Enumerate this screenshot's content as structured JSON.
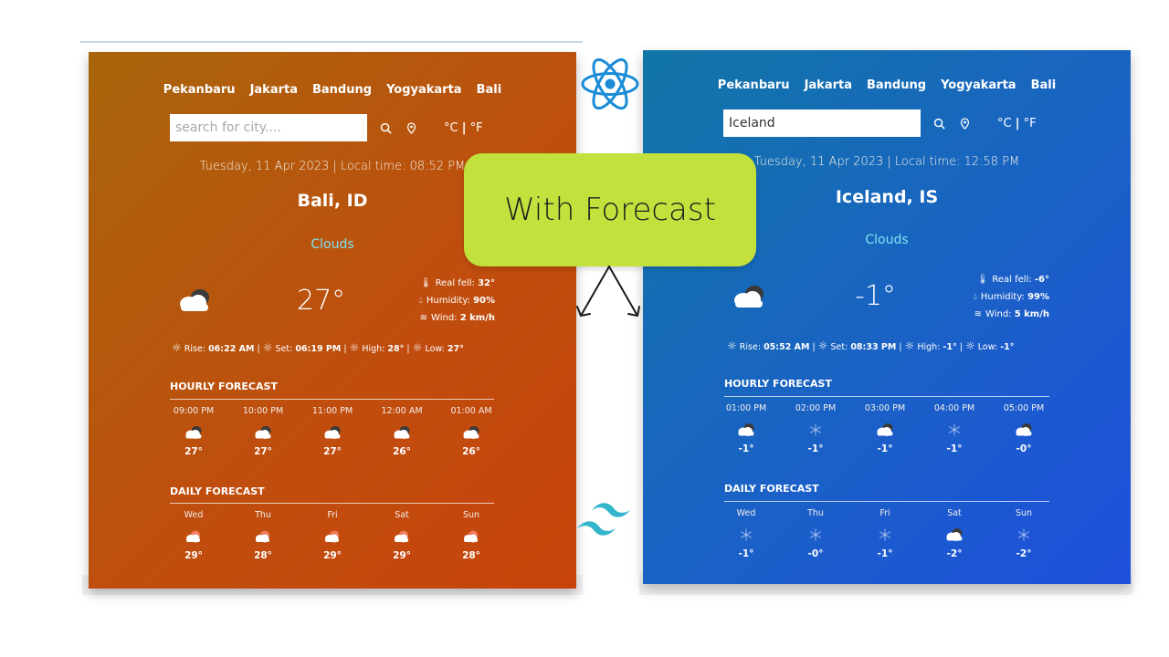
{
  "badge_text": "With Forecast",
  "left": {
    "nav": [
      "Pekanbaru",
      "Jakarta",
      "Bandung",
      "Yogyakarta",
      "Bali"
    ],
    "search": {
      "value": "",
      "placeholder": "search for city...."
    },
    "units": {
      "c": "°C",
      "sep": "|",
      "f": "°F"
    },
    "datetime": "Tuesday, 11 Apr 2023 | Local time: 08:52 PM",
    "city": "Bali, ID",
    "condition": "Clouds",
    "temp": "27°",
    "details": {
      "real_label": "Real fell: ",
      "real_value": "32°",
      "hum_label": "Humidity: ",
      "hum_value": "90%",
      "wind_label": "Wind: ",
      "wind_value": "2 km/h"
    },
    "sun": {
      "rise_label": "Rise: ",
      "rise": "06:22 AM",
      "set_label": "Set: ",
      "set": "06:19 PM",
      "high_label": "High: ",
      "high": "28°",
      "low_label": "Low: ",
      "low": "27°",
      "sep": "|"
    },
    "hourly_title": "Hourly Forecast",
    "hourly": [
      {
        "title": "09:00 PM",
        "temp": "27°",
        "icon": "cloud-icon"
      },
      {
        "title": "10:00 PM",
        "temp": "27°",
        "icon": "cloud-icon"
      },
      {
        "title": "11:00 PM",
        "temp": "27°",
        "icon": "cloud-icon"
      },
      {
        "title": "12:00 AM",
        "temp": "26°",
        "icon": "cloud-icon"
      },
      {
        "title": "01:00 AM",
        "temp": "26°",
        "icon": "cloud-icon"
      }
    ],
    "daily_title": "Daily Forecast",
    "daily": [
      {
        "title": "Wed",
        "temp": "29°",
        "icon": "rain-cloud-icon"
      },
      {
        "title": "Thu",
        "temp": "28°",
        "icon": "rain-cloud-icon"
      },
      {
        "title": "Fri",
        "temp": "29°",
        "icon": "rain-cloud-icon"
      },
      {
        "title": "Sat",
        "temp": "29°",
        "icon": "rain-cloud-icon"
      },
      {
        "title": "Sun",
        "temp": "28°",
        "icon": "rain-cloud-icon"
      }
    ]
  },
  "right": {
    "nav": [
      "Pekanbaru",
      "Jakarta",
      "Bandung",
      "Yogyakarta",
      "Bali"
    ],
    "search": {
      "value": "Iceland",
      "placeholder": ""
    },
    "units": {
      "c": "°C",
      "sep": "|",
      "f": "°F"
    },
    "datetime": "Tuesday, 11 Apr 2023 | Local time: 12:58 PM",
    "city": "Iceland, IS",
    "condition": "Clouds",
    "temp": "-1°",
    "details": {
      "real_label": "Real fell: ",
      "real_value": "-6°",
      "hum_label": "Humidity: ",
      "hum_value": "99%",
      "wind_label": "Wind: ",
      "wind_value": "5 km/h"
    },
    "sun": {
      "rise_label": "Rise: ",
      "rise": "05:52 AM",
      "set_label": "Set: ",
      "set": "08:33 PM",
      "high_label": "High: ",
      "high": "-1°",
      "low_label": "Low: ",
      "low": "-1°",
      "sep": "|"
    },
    "hourly_title": "Hourly Forecast",
    "hourly": [
      {
        "title": "01:00 PM",
        "temp": "-1°",
        "icon": "cloud-icon"
      },
      {
        "title": "02:00 PM",
        "temp": "-1°",
        "icon": "snow-icon"
      },
      {
        "title": "03:00 PM",
        "temp": "-1°",
        "icon": "cloud-icon"
      },
      {
        "title": "04:00 PM",
        "temp": "-1°",
        "icon": "snow-icon"
      },
      {
        "title": "05:00 PM",
        "temp": "-0°",
        "icon": "cloud-icon"
      }
    ],
    "daily_title": "Daily Forecast",
    "daily": [
      {
        "title": "Wed",
        "temp": "-1°",
        "icon": "snow-icon"
      },
      {
        "title": "Thu",
        "temp": "-0°",
        "icon": "snow-icon"
      },
      {
        "title": "Fri",
        "temp": "-1°",
        "icon": "snow-icon"
      },
      {
        "title": "Sat",
        "temp": "-2°",
        "icon": "cloud-icon"
      },
      {
        "title": "Sun",
        "temp": "-2°",
        "icon": "snow-icon"
      }
    ]
  }
}
